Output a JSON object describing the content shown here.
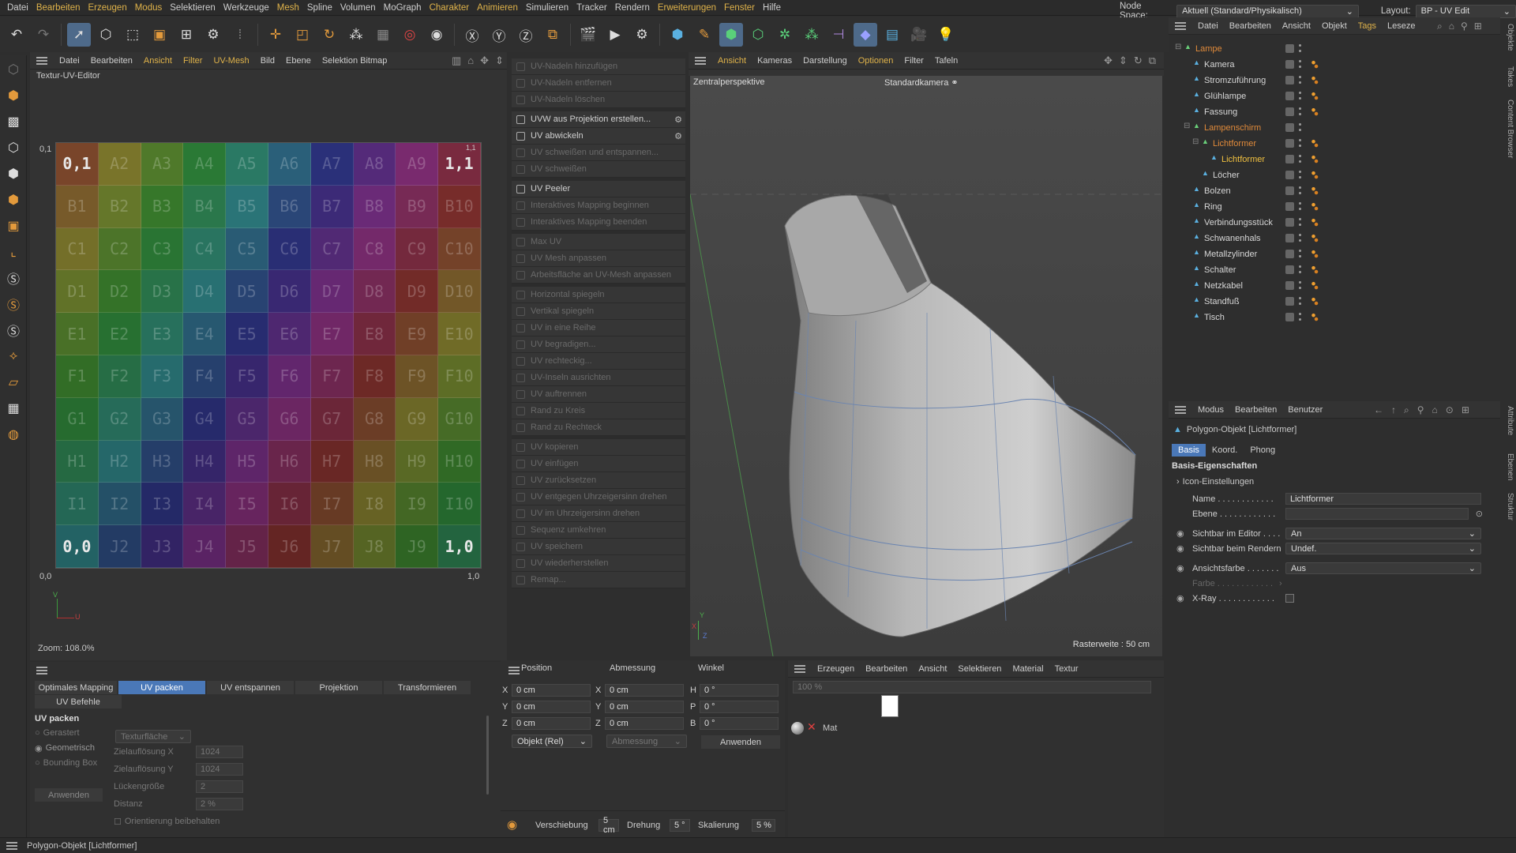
{
  "menu": [
    "Datei",
    "Bearbeiten",
    "Erzeugen",
    "Modus",
    "Selektieren",
    "Werkzeuge",
    "Mesh",
    "Spline",
    "Volumen",
    "MoGraph",
    "Charakter",
    "Animieren",
    "Simulieren",
    "Tracker",
    "Rendern",
    "Erweiterungen",
    "Fenster",
    "Hilfe"
  ],
  "menu_highlight": [
    1,
    2,
    3,
    6,
    10,
    11,
    15,
    16
  ],
  "node_space_label": "Node Space:",
  "node_space_value": "Aktuell (Standard/Physikalisch)",
  "layout_label": "Layout:",
  "layout_value": "BP - UV Edit",
  "uv_editor": {
    "menu": [
      "Datei",
      "Bearbeiten",
      "Ansicht",
      "Filter",
      "UV-Mesh",
      "Bild",
      "Ebene",
      "Selektion Bitmap"
    ],
    "menu_highlight": [
      2,
      3,
      4
    ],
    "title": "Textur-UV-Editor",
    "label_01": "0,1",
    "label_11": "1,1",
    "label_00": "0,0",
    "label_10": "1,0",
    "axis_v": "V",
    "axis_u": "U",
    "zoom": "Zoom: 108.0%",
    "rows": [
      "A",
      "B",
      "C",
      "D",
      "E",
      "F",
      "G",
      "H",
      "I",
      "J"
    ]
  },
  "uv_commands": [
    {
      "label": "UV-Nadeln hinzufügen",
      "enabled": false
    },
    {
      "label": "UV-Nadeln entfernen",
      "enabled": false
    },
    {
      "label": "UV-Nadeln löschen",
      "enabled": false
    },
    {
      "label": "UVW aus Projektion erstellen...",
      "enabled": true,
      "gap": true,
      "gear": true
    },
    {
      "label": "UV abwickeln",
      "enabled": true,
      "gear": true
    },
    {
      "label": "UV schweißen und entspannen...",
      "enabled": false
    },
    {
      "label": "UV schweißen",
      "enabled": false
    },
    {
      "label": "UV Peeler",
      "enabled": true,
      "gap": true
    },
    {
      "label": "Interaktives Mapping beginnen",
      "enabled": false
    },
    {
      "label": "Interaktives Mapping beenden",
      "enabled": false
    },
    {
      "label": "Max UV",
      "enabled": false,
      "gap": true
    },
    {
      "label": "UV Mesh anpassen",
      "enabled": false
    },
    {
      "label": "Arbeitsfläche an UV-Mesh anpassen",
      "enabled": false
    },
    {
      "label": "Horizontal spiegeln",
      "enabled": false,
      "gap": true
    },
    {
      "label": "Vertikal spiegeln",
      "enabled": false
    },
    {
      "label": "UV in eine Reihe",
      "enabled": false
    },
    {
      "label": "UV begradigen...",
      "enabled": false
    },
    {
      "label": "UV rechteckig...",
      "enabled": false
    },
    {
      "label": "UV-Inseln ausrichten",
      "enabled": false
    },
    {
      "label": "UV auftrennen",
      "enabled": false
    },
    {
      "label": "Rand zu Kreis",
      "enabled": false
    },
    {
      "label": "Rand zu Rechteck",
      "enabled": false
    },
    {
      "label": "UV kopieren",
      "enabled": false,
      "gap": true
    },
    {
      "label": "UV einfügen",
      "enabled": false
    },
    {
      "label": "UV zurücksetzen",
      "enabled": false
    },
    {
      "label": "UV entgegen Uhrzeigersinn drehen",
      "enabled": false
    },
    {
      "label": "UV im Uhrzeigersinn drehen",
      "enabled": false
    },
    {
      "label": "Sequenz umkehren",
      "enabled": false
    },
    {
      "label": "UV speichern",
      "enabled": false
    },
    {
      "label": "UV wiederherstellen",
      "enabled": false
    },
    {
      "label": "Remap...",
      "enabled": false
    }
  ],
  "viewport": {
    "menu": [
      "Ansicht",
      "Kameras",
      "Darstellung",
      "Optionen",
      "Filter",
      "Tafeln"
    ],
    "menu_highlight": [
      0,
      3
    ],
    "perspective": "Zentralperspektive",
    "camera": "Standardkamera",
    "grid": "Rasterweite : 50 cm",
    "axis_x": "X",
    "axis_y": "Y",
    "axis_z": "Z"
  },
  "objects_panel": {
    "menu": [
      "Datei",
      "Bearbeiten",
      "Ansicht",
      "Objekt",
      "Tags",
      "Leseze"
    ],
    "menu_highlight": [
      4
    ],
    "items": [
      {
        "name": "Lampe",
        "indent": 0,
        "color": "#e08a3a",
        "exp": "-"
      },
      {
        "name": "Kamera",
        "indent": 1,
        "color": "#d6d6d6"
      },
      {
        "name": "Stromzuführung",
        "indent": 1,
        "color": "#d6d6d6"
      },
      {
        "name": "Glühlampe",
        "indent": 1,
        "color": "#d6d6d6"
      },
      {
        "name": "Fassung",
        "indent": 1,
        "color": "#d6d6d6"
      },
      {
        "name": "Lampenschirm",
        "indent": 1,
        "color": "#e08a3a",
        "exp": "-"
      },
      {
        "name": "Lichtformer",
        "indent": 2,
        "color": "#e08a3a",
        "exp": "-"
      },
      {
        "name": "Lichtformer",
        "indent": 3,
        "color": "#f0c040",
        "sel": true
      },
      {
        "name": "Löcher",
        "indent": 2,
        "color": "#d6d6d6"
      },
      {
        "name": "Bolzen",
        "indent": 1,
        "color": "#d6d6d6"
      },
      {
        "name": "Ring",
        "indent": 1,
        "color": "#d6d6d6"
      },
      {
        "name": "Verbindungsstück",
        "indent": 1,
        "color": "#d6d6d6"
      },
      {
        "name": "Schwanenhals",
        "indent": 1,
        "color": "#d6d6d6"
      },
      {
        "name": "Metallzylinder",
        "indent": 1,
        "color": "#d6d6d6"
      },
      {
        "name": "Schalter",
        "indent": 1,
        "color": "#d6d6d6"
      },
      {
        "name": "Netzkabel",
        "indent": 1,
        "color": "#d6d6d6"
      },
      {
        "name": "Standfuß",
        "indent": 1,
        "color": "#d6d6d6"
      },
      {
        "name": "Tisch",
        "indent": 1,
        "color": "#d6d6d6"
      }
    ]
  },
  "side_tabs": [
    "Objekte",
    "Takes",
    "Content Browser"
  ],
  "side_tabs2": [
    "Attribute",
    "Ebenen",
    "Struktur"
  ],
  "attributes": {
    "menu": [
      "Modus",
      "Bearbeiten",
      "Benutzer"
    ],
    "object_title": "Polygon-Objekt [Lichtformer]",
    "tabs": [
      "Basis",
      "Koord.",
      "Phong"
    ],
    "section": "Basis-Eigenschaften",
    "subsection": "Icon-Einstellungen",
    "name_label": "Name",
    "name_value": "Lichtformer",
    "layer_label": "Ebene",
    "vis_editor_label": "Sichtbar im Editor",
    "vis_editor_value": "An",
    "vis_render_label": "Sichtbar beim Rendern",
    "vis_render_value": "Undef.",
    "display_color_label": "Ansichtsfarbe",
    "display_color_value": "Aus",
    "color_label": "Farbe",
    "xray_label": "X-Ray"
  },
  "uv_tools": {
    "tabs": [
      "Optimales Mapping",
      "UV packen",
      "UV entspannen",
      "Projektion",
      "Transformieren"
    ],
    "tab2": "UV Befehle",
    "heading": "UV packen",
    "opt_rastered": "Gerastert",
    "opt_geometric": "Geometrisch",
    "opt_bbox": "Bounding Box",
    "tex_label": "Texturfläche",
    "res_x_label": "Zielauflösung X",
    "res_x_value": "1024",
    "res_y_label": "Zielauflösung Y",
    "res_y_value": "1024",
    "gap_label": "Lückengröße",
    "gap_value": "2",
    "dist_label": "Distanz",
    "dist_value": "2 %",
    "apply_label": "Anwenden",
    "orient_label": "Orientierung beibehalten"
  },
  "coords": {
    "pos_label": "Position",
    "size_label": "Abmessung",
    "angle_label": "Winkel",
    "x": "0 cm",
    "y": "0 cm",
    "z": "0 cm",
    "sx": "0 cm",
    "sy": "0 cm",
    "sz": "0 cm",
    "h": "0 °",
    "p": "0 °",
    "b": "0 °",
    "mode": "Objekt (Rel)",
    "size_mode": "Abmessung",
    "apply": "Anwenden",
    "move_label": "Verschiebung",
    "move_value": "5 cm",
    "rot_label": "Drehung",
    "rot_value": "5 °",
    "scale_label": "Skalierung",
    "scale_value": "5 %"
  },
  "materials": {
    "menu": [
      "Erzeugen",
      "Bearbeiten",
      "Ansicht",
      "Selektieren",
      "Material",
      "Textur"
    ],
    "zoom": "100 %",
    "mat_name": "Mat"
  },
  "status": "Polygon-Objekt [Lichtformer]"
}
